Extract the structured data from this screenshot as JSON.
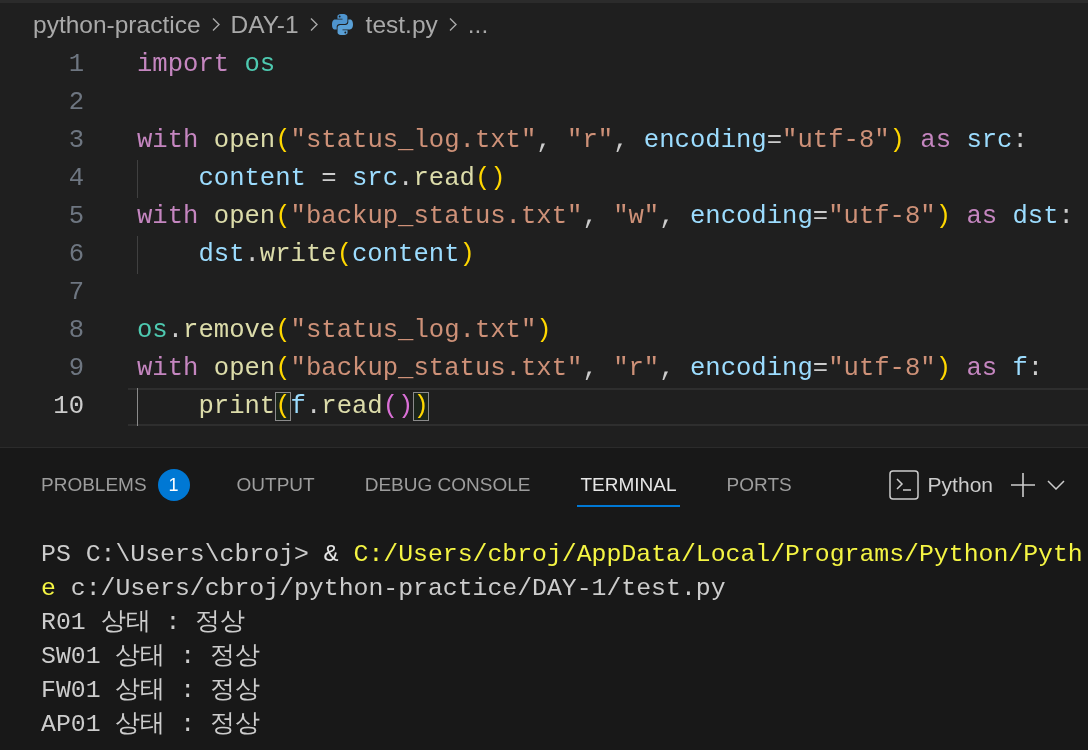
{
  "breadcrumb": {
    "items": [
      {
        "kind": "folder",
        "label": "python-practice"
      },
      {
        "kind": "folder",
        "label": "DAY-1"
      },
      {
        "kind": "file",
        "label": "test.py"
      },
      {
        "kind": "more",
        "label": "..."
      }
    ]
  },
  "editor": {
    "lines": [
      {
        "number": "1",
        "current": false,
        "words": [
          [
            {
              "kind": "keyword",
              "text": "import"
            }
          ],
          [
            {
              "kind": "module",
              "text": "os"
            }
          ]
        ]
      },
      {
        "number": "2",
        "current": false
      },
      {
        "number": "3",
        "current": false,
        "words": [
          [
            {
              "kind": "keyword",
              "text": "with"
            }
          ],
          [
            {
              "kind": "function",
              "text": "open"
            },
            {
              "kind": "bracket",
              "text": "(",
              "matched": false
            },
            {
              "kind": "string",
              "text": "\"status_log.txt\""
            },
            {
              "kind": "punct",
              "text": ","
            }
          ],
          [
            {
              "kind": "string",
              "text": "\"r\""
            },
            {
              "kind": "punct",
              "text": ","
            }
          ],
          [
            {
              "kind": "parameter",
              "text": "encoding"
            },
            {
              "kind": "punct",
              "text": "="
            },
            {
              "kind": "string",
              "text": "\"utf-8\""
            },
            {
              "kind": "bracket",
              "text": ")",
              "matched": false
            }
          ],
          [
            {
              "kind": "keyword",
              "text": "as"
            }
          ],
          [
            {
              "kind": "variable",
              "text": "src"
            },
            {
              "kind": "punct",
              "text": ":"
            }
          ]
        ],
        "children": [
          {
            "number": "4",
            "current": false,
            "words": [
              [
                {
                  "kind": "variable",
                  "text": "content"
                }
              ],
              [
                {
                  "kind": "punct",
                  "text": "="
                }
              ],
              [
                {
                  "kind": "variable",
                  "text": "src"
                },
                {
                  "kind": "punct",
                  "text": "."
                },
                {
                  "kind": "function",
                  "text": "read"
                },
                {
                  "kind": "bracket",
                  "text": "(",
                  "matched": false
                },
                {
                  "kind": "bracket",
                  "text": ")",
                  "matched": false
                }
              ]
            ]
          }
        ]
      },
      {
        "number": "5",
        "current": false,
        "words": [
          [
            {
              "kind": "keyword",
              "text": "with"
            }
          ],
          [
            {
              "kind": "function",
              "text": "open"
            },
            {
              "kind": "bracket",
              "text": "(",
              "matched": false
            },
            {
              "kind": "string",
              "text": "\"backup_status.txt\""
            },
            {
              "kind": "punct",
              "text": ","
            }
          ],
          [
            {
              "kind": "string",
              "text": "\"w\""
            },
            {
              "kind": "punct",
              "text": ","
            }
          ],
          [
            {
              "kind": "parameter",
              "text": "encoding"
            },
            {
              "kind": "punct",
              "text": "="
            },
            {
              "kind": "string",
              "text": "\"utf-8\""
            },
            {
              "kind": "bracket",
              "text": ")",
              "matched": false
            }
          ],
          [
            {
              "kind": "keyword",
              "text": "as"
            }
          ],
          [
            {
              "kind": "variable",
              "text": "dst"
            },
            {
              "kind": "punct",
              "text": ":"
            }
          ]
        ],
        "children": [
          {
            "number": "6",
            "current": false,
            "words": [
              [
                {
                  "kind": "variable",
                  "text": "dst"
                },
                {
                  "kind": "punct",
                  "text": "."
                },
                {
                  "kind": "function",
                  "text": "write"
                },
                {
                  "kind": "bracket",
                  "text": "(",
                  "matched": false
                },
                {
                  "kind": "variable",
                  "text": "content"
                },
                {
                  "kind": "bracket",
                  "text": ")",
                  "matched": false
                }
              ]
            ]
          }
        ]
      },
      {
        "number": "7",
        "current": false
      },
      {
        "number": "8",
        "current": false,
        "words": [
          [
            {
              "kind": "module",
              "text": "os"
            },
            {
              "kind": "punct",
              "text": "."
            },
            {
              "kind": "function",
              "text": "remove"
            },
            {
              "kind": "bracket",
              "text": "(",
              "matched": false
            },
            {
              "kind": "string",
              "text": "\"status_log.txt\""
            },
            {
              "kind": "bracket",
              "text": ")",
              "matched": false
            }
          ]
        ]
      },
      {
        "number": "9",
        "current": false,
        "words": [
          [
            {
              "kind": "keyword",
              "text": "with"
            }
          ],
          [
            {
              "kind": "function",
              "text": "open"
            },
            {
              "kind": "bracket",
              "text": "(",
              "matched": false
            },
            {
              "kind": "string",
              "text": "\"backup_status.txt\""
            },
            {
              "kind": "punct",
              "text": ","
            }
          ],
          [
            {
              "kind": "string",
              "text": "\"r\""
            },
            {
              "kind": "punct",
              "text": ","
            }
          ],
          [
            {
              "kind": "parameter",
              "text": "encoding"
            },
            {
              "kind": "punct",
              "text": "="
            },
            {
              "kind": "string",
              "text": "\"utf-8\""
            },
            {
              "kind": "bracket",
              "text": ")",
              "matched": false
            }
          ],
          [
            {
              "kind": "keyword",
              "text": "as"
            }
          ],
          [
            {
              "kind": "variable",
              "text": "f"
            },
            {
              "kind": "punct",
              "text": ":"
            }
          ]
        ],
        "children": [
          {
            "number": "10",
            "current": true,
            "words": [
              [
                {
                  "kind": "function",
                  "text": "print"
                },
                {
                  "kind": "bracket",
                  "text": "(",
                  "matched": true
                },
                {
                  "kind": "variable",
                  "text": "f"
                },
                {
                  "kind": "punct",
                  "text": "."
                },
                {
                  "kind": "function",
                  "text": "read"
                },
                {
                  "kind": "bracket",
                  "text": "(",
                  "matched": false
                },
                {
                  "kind": "bracket",
                  "text": ")",
                  "matched": false
                },
                {
                  "kind": "bracket",
                  "text": ")",
                  "matched": true
                }
              ]
            ]
          }
        ]
      }
    ]
  },
  "panel": {
    "tabs": [
      {
        "label": "PROBLEMS",
        "selected": false,
        "badge": "1"
      },
      {
        "label": "OUTPUT",
        "selected": false
      },
      {
        "label": "DEBUG CONSOLE",
        "selected": false
      },
      {
        "label": "TERMINAL",
        "selected": true
      },
      {
        "label": "PORTS",
        "selected": false
      }
    ],
    "terminal_tab": {
      "label": "Python"
    }
  },
  "terminal": {
    "lines": [
      {
        "segments": [
          {
            "kind": "prompt",
            "text": "PS C:\\Users\\cbroj>"
          },
          {
            "kind": "operator",
            "text": "&"
          },
          {
            "kind": "command",
            "text": "C:/Users/cbroj/AppData/Local/Programs/Python/Pyth"
          }
        ]
      },
      {
        "segments": [
          {
            "kind": "command",
            "text": "e"
          },
          {
            "kind": "argument",
            "text": "c:/Users/cbroj/python-practice/DAY-1/test.py"
          }
        ]
      },
      {
        "segments": [
          {
            "kind": "output",
            "text": "R01 상태 : 정상"
          }
        ]
      },
      {
        "segments": [
          {
            "kind": "output",
            "text": "SW01 상태 : 정상"
          }
        ]
      },
      {
        "segments": [
          {
            "kind": "output",
            "text": "FW01 상태 : 정상"
          }
        ]
      },
      {
        "segments": [
          {
            "kind": "output",
            "text": "AP01 상태 : 정상"
          }
        ]
      }
    ]
  }
}
